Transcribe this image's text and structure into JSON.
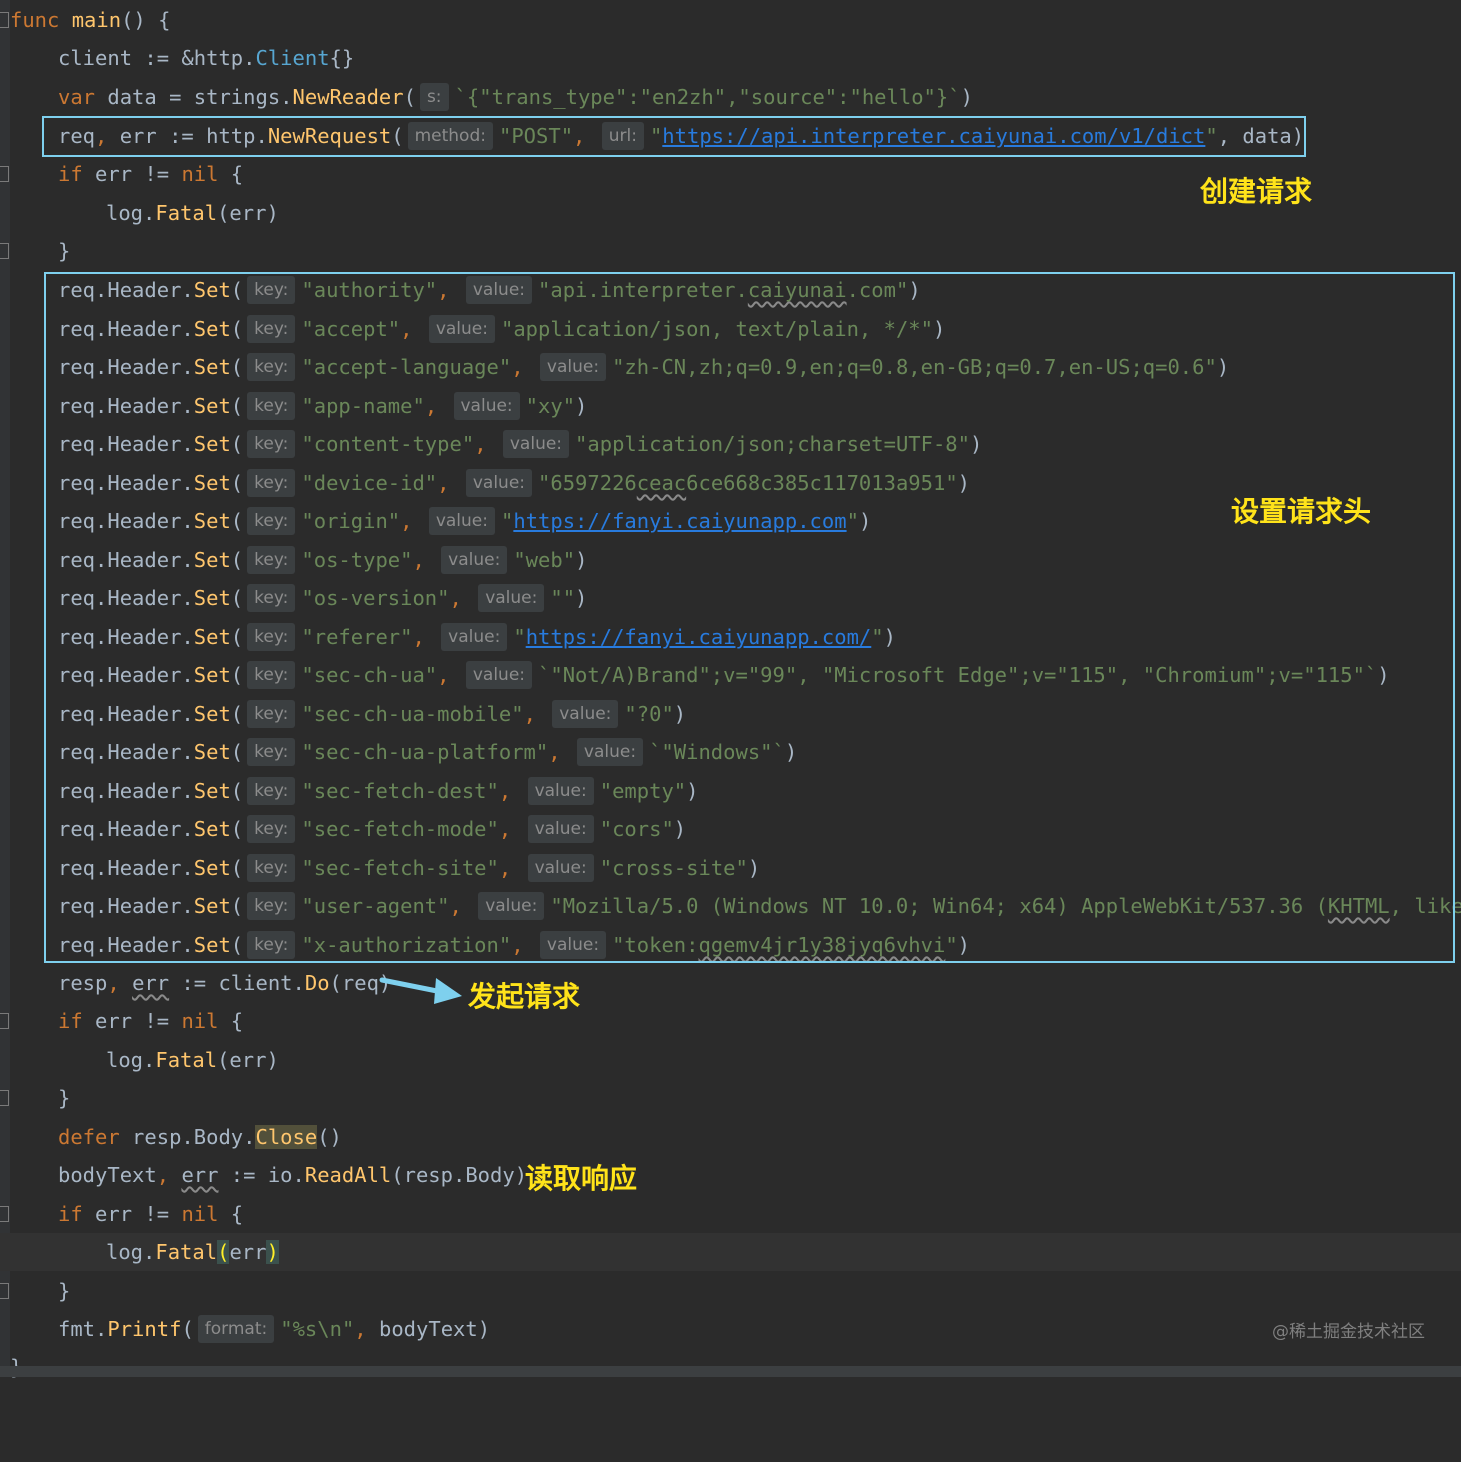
{
  "hints": {
    "s": "s:",
    "method": "method:",
    "url": "url:",
    "key": "key:",
    "value": "value:",
    "format": "format:"
  },
  "code": {
    "func_kw": "func",
    "main_name": "main",
    "main_tail": "() {",
    "l2": "client := &http.",
    "l2_type": "Client",
    "l2_tail": "{}",
    "l3_kw": "var",
    "l3_a": " data = strings.",
    "l3_fn": "NewReader",
    "l3_b": "(",
    "l3_str": "`{\"trans_type\":\"en2zh\",\"source\":\"hello\"}`",
    "l3_c": ")",
    "l4_a": "req",
    "l4_comma": ",",
    "l4_b": " err := http.",
    "l4_fn": "NewRequest",
    "l4_c": "(",
    "l4_post": "\"POST\"",
    "l4_d": ",",
    "l4_q1": "\"",
    "l4_url": "https://api.interpreter.caiyunai.com/v1/dict",
    "l4_q2": "\"",
    "l4_e": ", data)",
    "if_kw": "if",
    "if_mid": " err != ",
    "nil_kw": "nil",
    "if_tail": " {",
    "log_a": "log.",
    "log_fn": "Fatal",
    "log_b": "(err)",
    "log_open": "(",
    "log_err": "err",
    "log_close": ")",
    "close_brace": "}",
    "hs_prefix": "req.Header.",
    "hs_fn": "Set",
    "hs_open": "(",
    "hs_comma": ",",
    "hs_close": ")",
    "resp_a": "resp",
    "resp_comma": ",",
    "resp_err": "err",
    "resp_b": " := client.",
    "resp_fn": "Do",
    "resp_c": "(req)",
    "defer_kw": "defer",
    "defer_a": " resp.Body.",
    "defer_fn": "Close",
    "defer_b": "()",
    "body_a": "bodyText",
    "body_comma": ",",
    "body_err": "err",
    "body_b": " := io.",
    "body_fn": "ReadAll",
    "body_c": "(resp.Body)",
    "fmt_a": "fmt.",
    "fmt_fn": "Printf",
    "fmt_b": "(",
    "fmt_str": "\"%s\\n\"",
    "fmt_comma": ",",
    "fmt_c": " bodyText)",
    "end_brace": "}"
  },
  "headers": [
    {
      "k": "\"authority\"",
      "v_pre": "\"api.interpreter.",
      "v_warn": "caiyunai",
      "v_post": ".com\"",
      "tail": ")"
    },
    {
      "k": "\"accept\"",
      "v": "\"application/json, text/plain, */*\"",
      "tail": ")"
    },
    {
      "k": "\"accept-language\"",
      "v": "\"zh-CN,zh;q=0.9,en;q=0.8,en-GB;q=0.7,en-US;q=0.6\"",
      "tail": ")"
    },
    {
      "k": "\"app-name\"",
      "v": "\"xy\"",
      "tail": ")"
    },
    {
      "k": "\"content-type\"",
      "v": "\"application/json;charset=UTF-8\"",
      "tail": ")"
    },
    {
      "k": "\"device-id\"",
      "v_pre": "\"6597226",
      "v_warn": "ceac",
      "v_post": "6ce668c385c117013a951\"",
      "tail": ")"
    },
    {
      "k": "\"origin\"",
      "v_q1": "\"",
      "v_link": "https://fanyi.caiyunapp.com",
      "v_q2": "\"",
      "tail": ")"
    },
    {
      "k": "\"os-type\"",
      "v": "\"web\"",
      "tail": ")"
    },
    {
      "k": "\"os-version\"",
      "v": "\"\"",
      "tail": ")"
    },
    {
      "k": "\"referer\"",
      "v_q1": "\"",
      "v_link": "https://fanyi.caiyunapp.com/",
      "v_q2": "\"",
      "tail": ")"
    },
    {
      "k": "\"sec-ch-ua\"",
      "v": "`\"Not/A)Brand\";v=\"99\", \"Microsoft Edge\";v=\"115\", \"Chromium\";v=\"115\"`",
      "tail": ")"
    },
    {
      "k": "\"sec-ch-ua-mobile\"",
      "v": "\"?0\"",
      "tail": ")"
    },
    {
      "k": "\"sec-ch-ua-platform\"",
      "v": "`\"Windows\"`",
      "tail": ")"
    },
    {
      "k": "\"sec-fetch-dest\"",
      "v": "\"empty\"",
      "tail": ")"
    },
    {
      "k": "\"sec-fetch-mode\"",
      "v": "\"cors\"",
      "tail": ")"
    },
    {
      "k": "\"sec-fetch-site\"",
      "v": "\"cross-site\"",
      "tail": ")"
    },
    {
      "k": "\"user-agent\"",
      "v_pre": "\"Mozilla/5.0 (Windows NT 10.0; Win64; x64) AppleWebKit/537.36 (",
      "v_warn": "KHTML",
      "v_post": ", like",
      "tail": ""
    },
    {
      "k": "\"x-authorization\"",
      "v_pre": "\"token:",
      "v_warn": "qgemv4jr1y38jyq6vhvi",
      "v_post": "\"",
      "tail": ")"
    }
  ],
  "annotations": {
    "create_request": "创建请求",
    "set_headers": "设置请求头",
    "send_request": "发起请求",
    "read_response": "读取响应"
  },
  "colors": {
    "box_border": "#7ed0ee",
    "annotation": "#ffe31a",
    "arrow": "#7ed0ee"
  },
  "watermark": "@稀土掘金技术社区"
}
